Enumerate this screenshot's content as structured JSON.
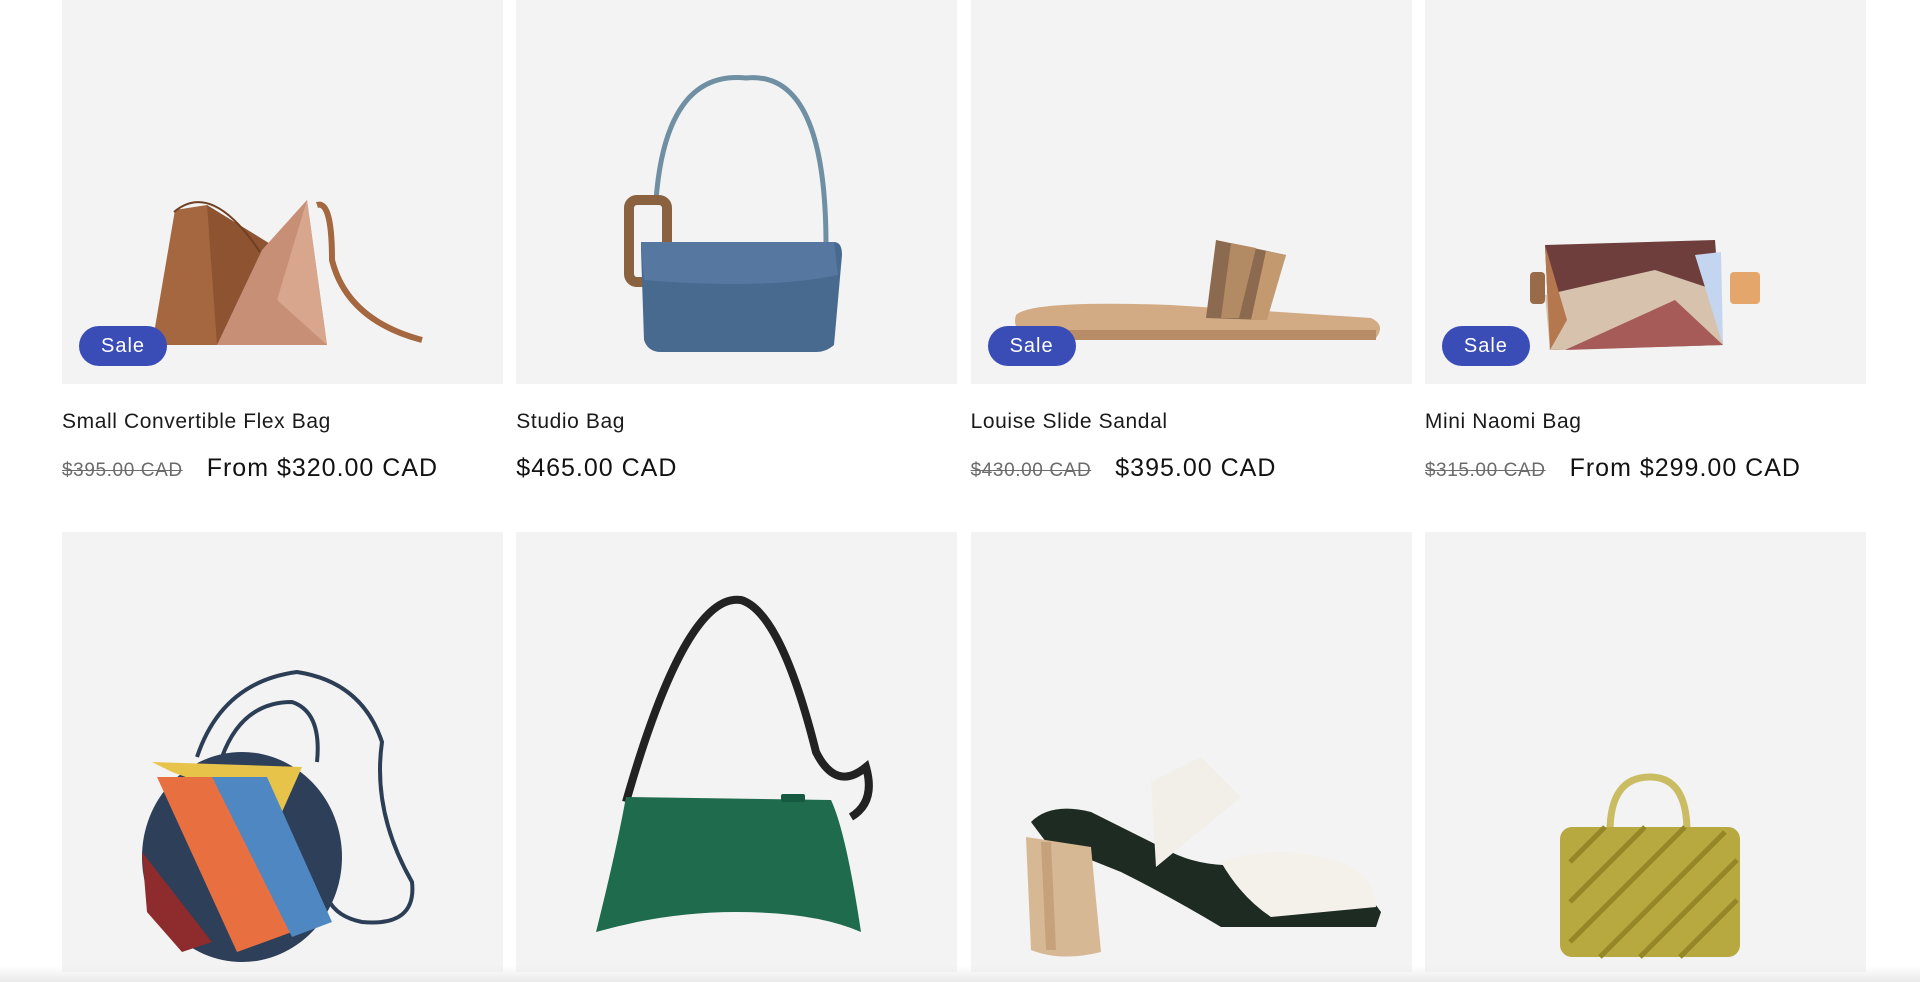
{
  "products": [
    {
      "title": "Small Convertible Flex Bag",
      "badge": "Sale",
      "price_compare": "$395.00 CAD",
      "price": "From $320.00 CAD"
    },
    {
      "title": "Studio Bag",
      "badge": "",
      "price_compare": "",
      "price": "$465.00 CAD"
    },
    {
      "title": "Louise Slide Sandal",
      "badge": "Sale",
      "price_compare": "$430.00 CAD",
      "price": "$395.00 CAD"
    },
    {
      "title": "Mini Naomi Bag",
      "badge": "Sale",
      "price_compare": "$315.00 CAD",
      "price": "From $299.00 CAD"
    },
    {
      "image": "striped-bucket-bag"
    },
    {
      "image": "green-shoulder-bag"
    },
    {
      "image": "white-heeled-mule"
    },
    {
      "image": "olive-top-handle-bag"
    }
  ],
  "colors": {
    "badge_bg": "#3a4cb6",
    "card_bg": "#f3f3f3",
    "text": "#121212",
    "compare_price": "#6b6b6b"
  }
}
